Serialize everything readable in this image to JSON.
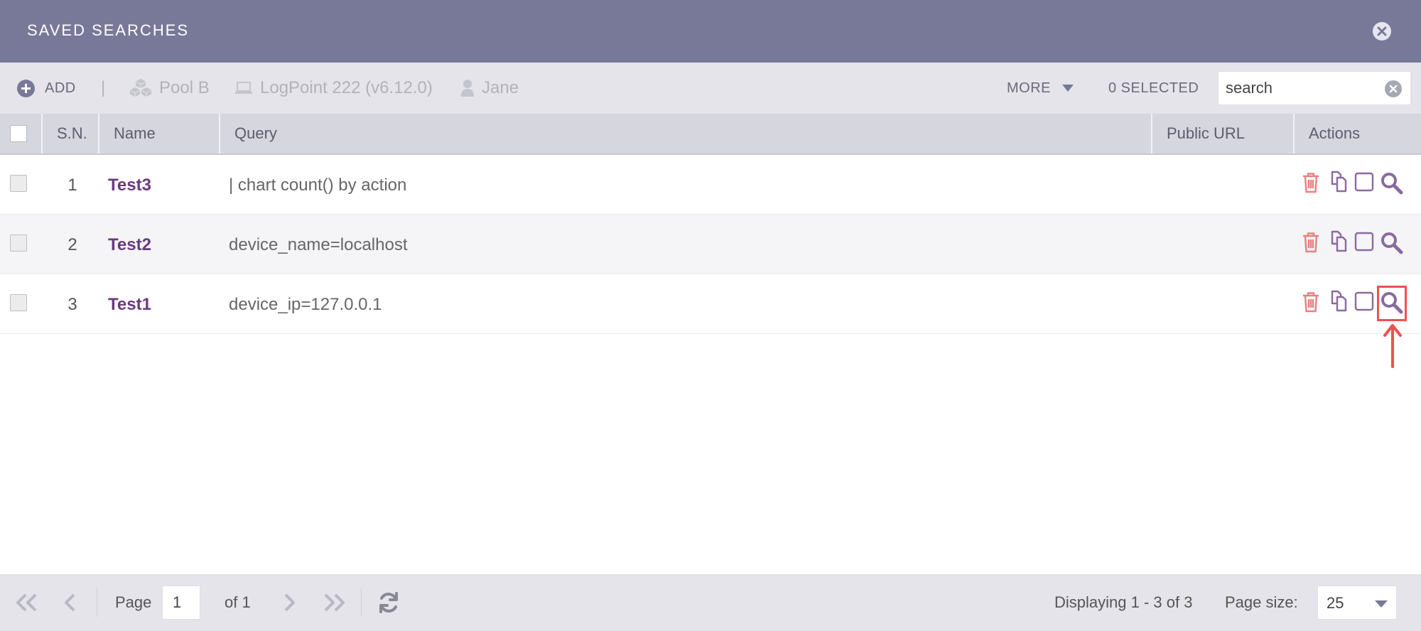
{
  "dialog": {
    "title": "SAVED SEARCHES"
  },
  "toolbar": {
    "add_label": "ADD",
    "separator": "|",
    "pool_label": "Pool B",
    "logpoint_label": "LogPoint 222 (v6.12.0)",
    "user_label": "Jane",
    "more_label": "MORE",
    "selected_label": "0 SELECTED",
    "search_value": "search"
  },
  "table": {
    "headers": {
      "sn": "S.N.",
      "name": "Name",
      "query": "Query",
      "public_url": "Public URL",
      "actions": "Actions"
    },
    "rows": [
      {
        "sn": "1",
        "name": "Test3",
        "query": "| chart count() by action",
        "public_url": ""
      },
      {
        "sn": "2",
        "name": "Test2",
        "query": "device_name=localhost",
        "public_url": ""
      },
      {
        "sn": "3",
        "name": "Test1",
        "query": "device_ip=127.0.0.1",
        "public_url": ""
      }
    ]
  },
  "pagination": {
    "page_label": "Page",
    "current_page": "1",
    "of_label": "of 1",
    "displaying": "Displaying 1 - 3 of 3",
    "page_size_label": "Page size:",
    "page_size": "25"
  },
  "colors": {
    "title_bar": "#787898",
    "toolbar_bg": "#e4e4ea",
    "header_bg": "#d6d6de",
    "name_link": "#6a3a7e",
    "delete_icon": "#e8807e",
    "action_icon": "#8a6aa0",
    "highlight": "#f05050"
  },
  "icons": {
    "close": "close-circle-icon",
    "add": "plus-circle-icon",
    "pool": "cubes-icon",
    "logpoint": "laptop-icon",
    "user": "user-icon",
    "more": "caret-down-icon",
    "search_clear": "clear-circle-icon",
    "delete": "trash-icon",
    "copy": "copy-icon",
    "checkbox": "square-icon",
    "run": "search-icon",
    "first": "double-chevron-left-icon",
    "prev": "chevron-left-icon",
    "next": "chevron-right-icon",
    "last": "double-chevron-right-icon",
    "refresh": "refresh-icon"
  }
}
